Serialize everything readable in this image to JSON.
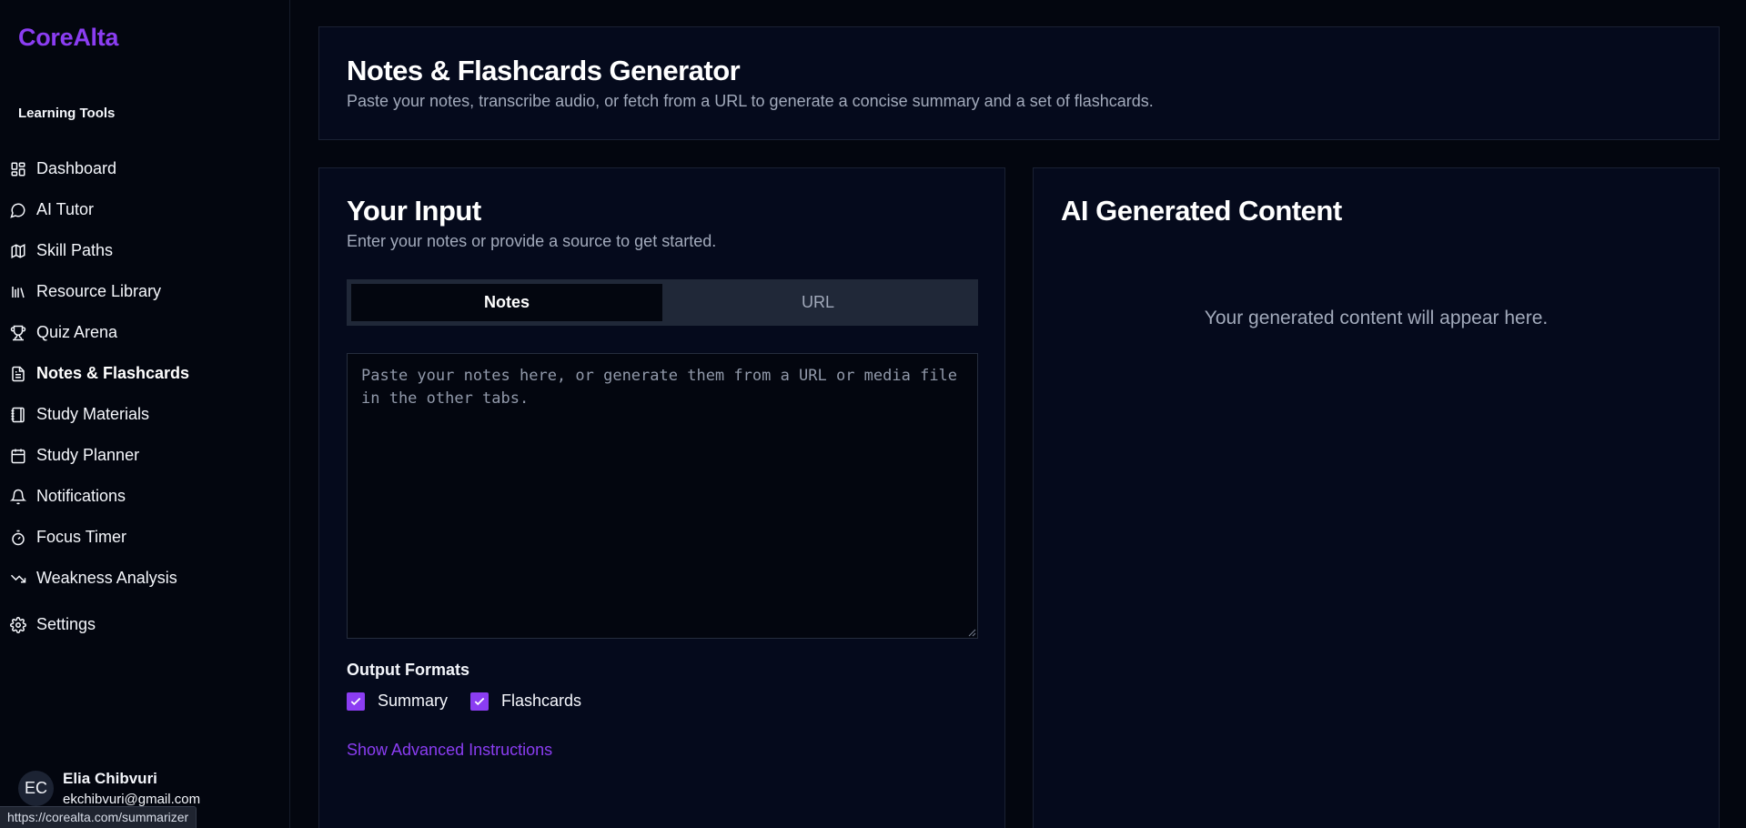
{
  "brand": "CoreAlta",
  "sidebar": {
    "section_label": "Learning Tools",
    "items": [
      {
        "label": "Dashboard",
        "icon": "dashboard-icon"
      },
      {
        "label": "AI Tutor",
        "icon": "chat-bubble-icon"
      },
      {
        "label": "Skill Paths",
        "icon": "map-icon"
      },
      {
        "label": "Resource Library",
        "icon": "library-icon"
      },
      {
        "label": "Quiz Arena",
        "icon": "trophy-icon"
      },
      {
        "label": "Notes & Flashcards",
        "icon": "document-icon"
      },
      {
        "label": "Study Materials",
        "icon": "notebook-icon"
      },
      {
        "label": "Study Planner",
        "icon": "calendar-icon"
      },
      {
        "label": "Notifications",
        "icon": "bell-icon"
      },
      {
        "label": "Focus Timer",
        "icon": "timer-icon"
      },
      {
        "label": "Weakness Analysis",
        "icon": "trending-down-icon"
      }
    ],
    "active_item": "Notes & Flashcards",
    "settings_label": "Settings"
  },
  "user": {
    "initials": "EC",
    "name": "Elia Chibvuri",
    "email": "ekchibvuri@gmail.com"
  },
  "status_url": "https://corealta.com/summarizer",
  "header": {
    "title": "Notes & Flashcards Generator",
    "subtitle": "Paste your notes, transcribe audio, or fetch from a URL to generate a concise summary and a set of flashcards."
  },
  "input_card": {
    "title": "Your Input",
    "description": "Enter your notes or provide a source to get started.",
    "tabs": [
      {
        "label": "Notes",
        "active": true
      },
      {
        "label": "URL",
        "active": false
      }
    ],
    "textarea_value": "",
    "textarea_placeholder": "Paste your notes here, or generate them from a URL or media file in the other tabs.",
    "formats_label": "Output Formats",
    "formats": [
      {
        "label": "Summary",
        "checked": true
      },
      {
        "label": "Flashcards",
        "checked": true
      }
    ],
    "advanced_link": "Show Advanced Instructions"
  },
  "output_card": {
    "title": "AI Generated Content",
    "placeholder": "Your generated content will appear here."
  },
  "colors": {
    "accent": "#8b3df2",
    "background": "#03060f",
    "panel": "#050a1c",
    "muted_text": "#a2aabb"
  }
}
